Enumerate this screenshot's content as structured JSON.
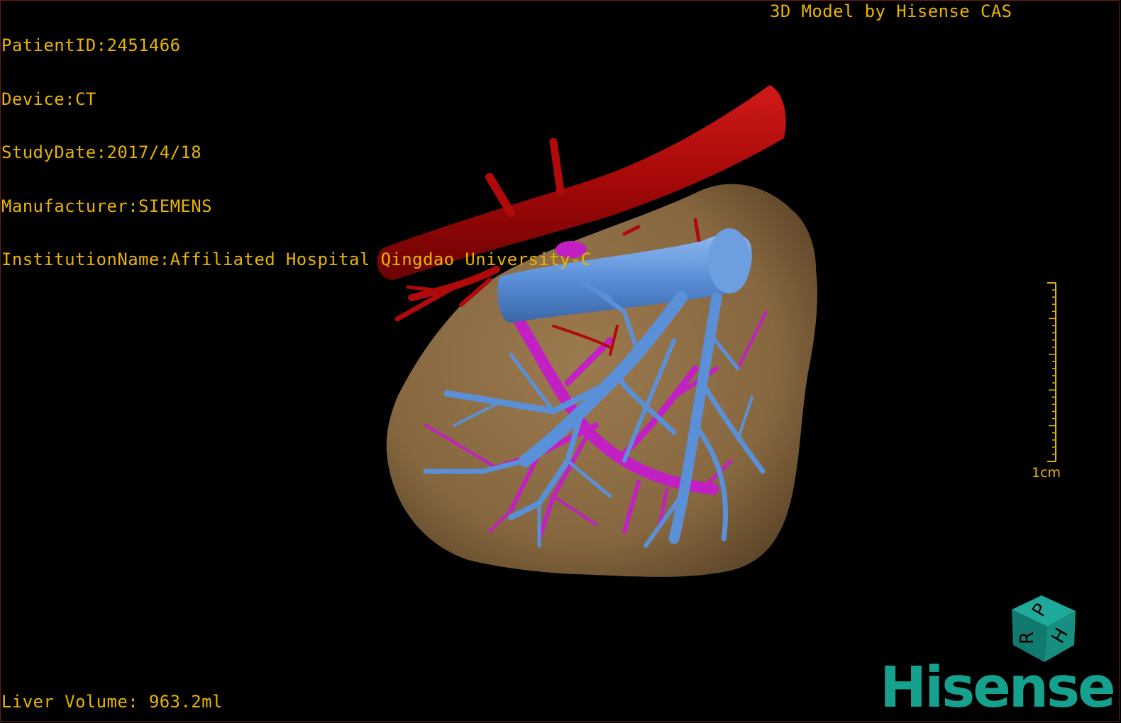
{
  "patient_info": {
    "patient_id": "PatientID:2451466",
    "device": "Device:CT",
    "study_date": "StudyDate:2017/4/18",
    "manufacturer": "Manufacturer:SIEMENS",
    "institution": "InstitutionName:Affiliated Hospital Qingdao University-C"
  },
  "model_credit": "3D Model by Hisense CAS",
  "liver_volume": "Liver Volume: 963.2ml",
  "scale_bar": {
    "label": "1cm"
  },
  "orientation_cube": {
    "faces": [
      "P",
      "H",
      "R"
    ]
  },
  "brand": "Hisense",
  "colors": {
    "overlay_text": "#e8b400",
    "liver": "#8c6a45",
    "artery": "#b00a0a",
    "portal_vein": "#c21fc4",
    "hepatic_vein": "#5a90d8",
    "brand": "#16a08e"
  },
  "icons": {
    "orientation": "orientation-cube-icon",
    "scale": "scale-ruler-icon"
  }
}
